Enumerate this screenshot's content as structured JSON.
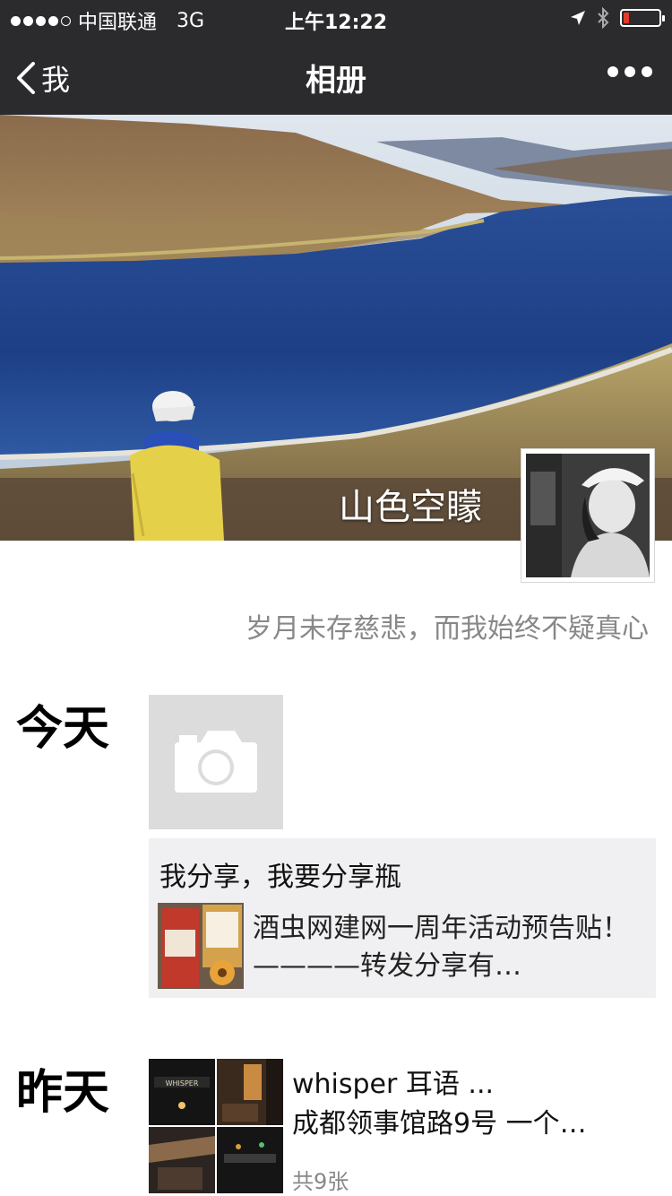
{
  "status_bar": {
    "carrier": "中国联通",
    "network": "3G",
    "time": "上午12:22",
    "battery_level": 0.15
  },
  "nav": {
    "back_label": "我",
    "title": "相册"
  },
  "profile": {
    "nickname": "山色空矇",
    "signature": "岁月未存慈悲，而我始终不疑真心"
  },
  "timeline": {
    "today": {
      "label": "今天",
      "share_title": "我分享，我要分享瓶",
      "share_text": "酒虫网建网一周年活动预告贴！ ————转发分享有…"
    },
    "yesterday": {
      "label": "昨天",
      "post_line1": "whisper 耳语 ...",
      "post_line2": "成都领事馆路9号 一个…",
      "photo_count": "共9张",
      "grid_sign_text": "WHISPER"
    }
  },
  "colors": {
    "bar_background": "#2b2b2d",
    "card_background": "#f0f0f2",
    "placeholder_background": "#dcdcdc"
  }
}
